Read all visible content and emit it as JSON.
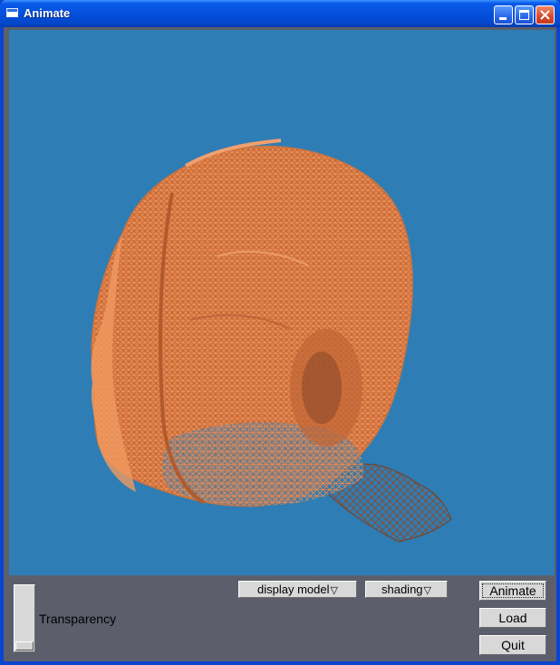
{
  "window": {
    "title": "Animate",
    "controls": [
      "minimize",
      "maximize",
      "close"
    ]
  },
  "viewport": {
    "background_color": "#2e7db5",
    "model_color": "#e8894f",
    "content": "3D wireframe head model"
  },
  "controls": {
    "display_model_label": "display model",
    "shading_label": "shading",
    "dropdown_arrow": "▽",
    "animate_label": "Animate",
    "load_label": "Load",
    "quit_label": "Quit",
    "transparency_label": "Transparency",
    "transparency_value": 0
  }
}
